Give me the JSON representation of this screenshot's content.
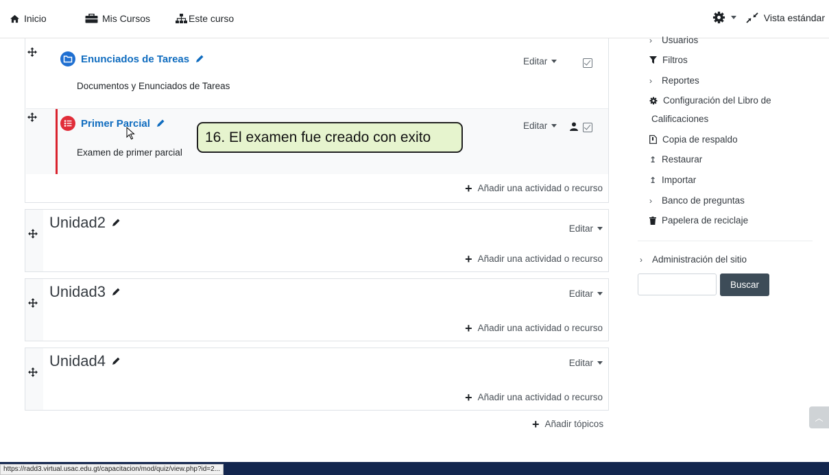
{
  "nav": {
    "inicio": "Inicio",
    "mis_cursos": "Mis Cursos",
    "este_curso": "Este curso",
    "vista": "Vista estándar"
  },
  "section0": {
    "activity1": {
      "title": "Enunciados de Tareas",
      "desc": "Documentos y Enunciados de Tareas",
      "editar": "Editar"
    },
    "activity2": {
      "title": "Primer Parcial",
      "desc": "Examen de primer parcial",
      "editar": "Editar"
    },
    "add": "Añadir una actividad o recurso"
  },
  "units": [
    {
      "title": "Unidad2",
      "editar": "Editar",
      "add": "Añadir una actividad o recurso"
    },
    {
      "title": "Unidad3",
      "editar": "Editar",
      "add": "Añadir una actividad o recurso"
    },
    {
      "title": "Unidad4",
      "editar": "Editar",
      "add": "Añadir una actividad o recurso"
    }
  ],
  "add_topics": "Añadir tópicos",
  "callout": "16. El examen fue creado con exito",
  "sidebar": {
    "usuarios": "Usuarios",
    "filtros": "Filtros",
    "reportes": "Reportes",
    "config_1": "Configuración del Libro de",
    "config_2": "Calificaciones",
    "copia": "Copia de respaldo",
    "restaurar": "Restaurar",
    "importar": "Importar",
    "banco": "Banco de preguntas",
    "papelera": "Papelera de reciclaje",
    "admin": "Administración del sitio",
    "buscar": "Buscar"
  },
  "status_url": "https://radd3.virtual.usac.edu.gt/capacitacion/mod/quiz/view.php?id=2...",
  "colors": {
    "link": "#0f6cbf",
    "footer": "#13264e",
    "callout_bg": "#e6f4ce",
    "quiz_icon": "#e12d39",
    "folder_icon": "#1f6fd1",
    "highlight_border": "#d9232e"
  }
}
